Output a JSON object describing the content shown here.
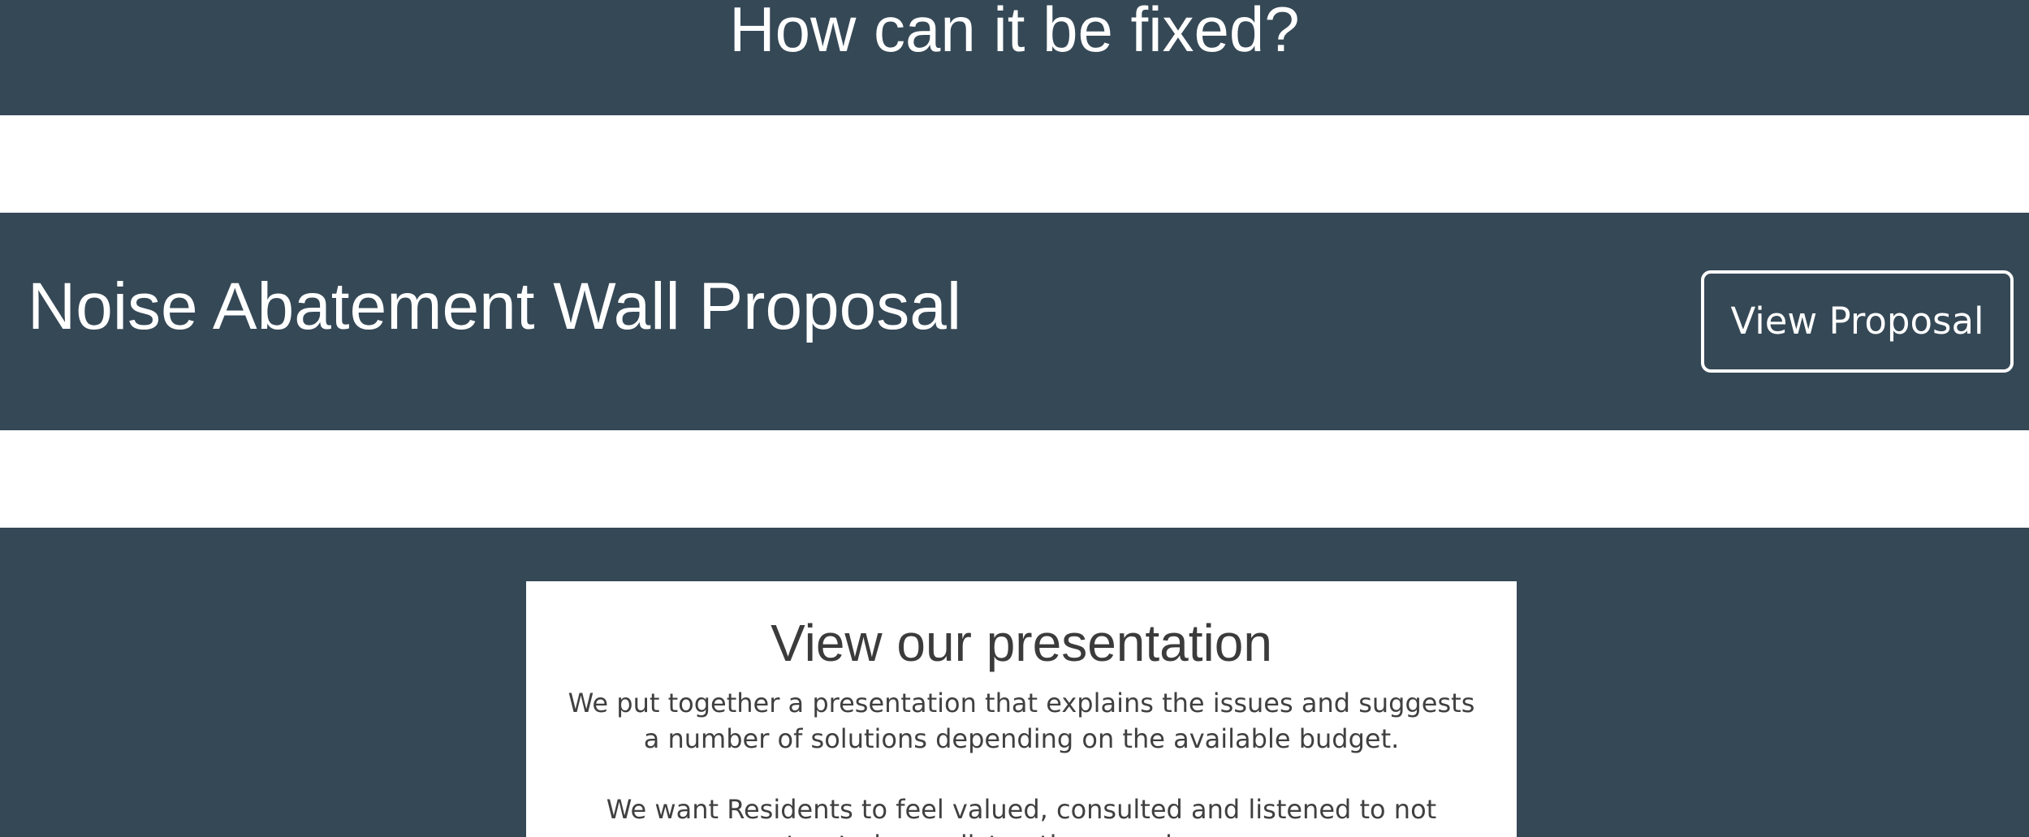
{
  "top_section": {
    "heading": "How can it be fixed?"
  },
  "proposal_section": {
    "title": "Noise Abatement Wall Proposal",
    "button_label": "View Proposal"
  },
  "presentation_section": {
    "heading": "View our presentation",
    "paragraph_1": "We put together a presentation that explains the issues and suggests a number of solutions depending on the available budget.",
    "paragraph_2": "We want Residents to feel valued, consulted and listened to not treated as a distraction or nuisance."
  },
  "colors": {
    "band_background": "#354856",
    "page_background": "#ffffff",
    "card_text": "#404040"
  }
}
